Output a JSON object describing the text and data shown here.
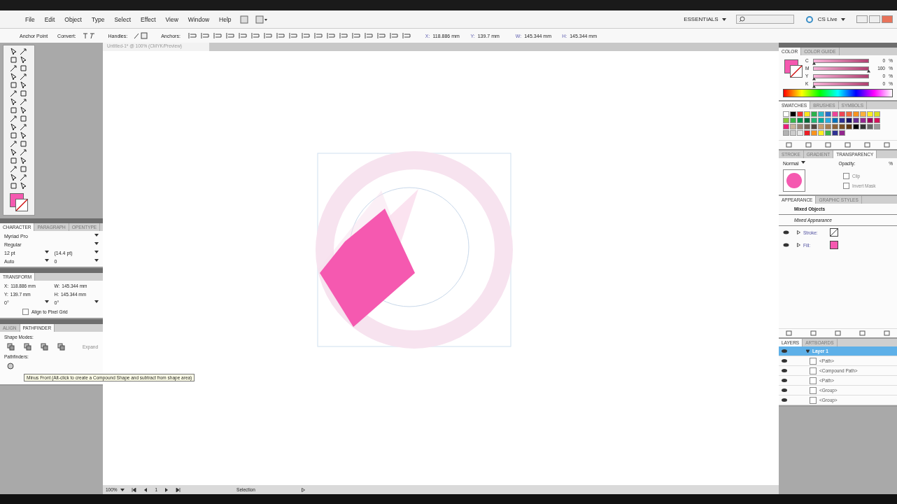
{
  "menu": [
    "File",
    "Edit",
    "Object",
    "Type",
    "Select",
    "Effect",
    "View",
    "Window",
    "Help"
  ],
  "workspace": "ESSENTIALS",
  "cs_live": "CS Live",
  "control_bar": {
    "tool": "Anchor Point",
    "convert": "Convert:",
    "handles": "Handles:",
    "anchors": "Anchors:",
    "fields": [
      {
        "label": "X:",
        "value": "118.886 mm"
      },
      {
        "label": "Y:",
        "value": "139.7 mm"
      },
      {
        "label": "W:",
        "value": "145.344 mm"
      },
      {
        "label": "H:",
        "value": "145.344 mm"
      }
    ]
  },
  "document_tab": "Untitled-1* @ 100% (CMYK/Preview)",
  "character": {
    "tabs": [
      {
        "label": "CHARACTER",
        "selected": true
      },
      {
        "label": "PARAGRAPH",
        "selected": false
      },
      {
        "label": "OPENTYPE",
        "selected": false
      }
    ],
    "font": "Myriad Pro",
    "style": "Regular",
    "size": "12 pt",
    "leading": "(14.4 pt)",
    "kerning": "Auto",
    "tracking": "0"
  },
  "transform": {
    "title": "TRANSFORM",
    "fields": [
      {
        "label": "X:",
        "value": "118.886 mm"
      },
      {
        "label": "W:",
        "value": "145.344 mm"
      },
      {
        "label": "Y:",
        "value": "139.7 mm"
      },
      {
        "label": "H:",
        "value": "145.344 mm"
      }
    ],
    "rotate": "0°",
    "shear": "0°",
    "pixel_grid": {
      "label": "Align to Pixel Grid",
      "checked": false
    }
  },
  "pathfinder": {
    "tabs": [
      {
        "label": "ALIGN",
        "selected": false
      },
      {
        "label": "PATHFINDER",
        "selected": true
      }
    ],
    "shape_modes": "Shape Modes:",
    "expand": {
      "label": "Expand",
      "disabled": true
    },
    "pathfinders": "Pathfinders:",
    "tooltip": "Minus Front (Alt-click to create a Compound Shape and subtract from shape area)"
  },
  "color": {
    "tabs": [
      {
        "label": "COLOR",
        "selected": true
      },
      {
        "label": "COLOR GUIDE",
        "selected": false
      }
    ],
    "channels": [
      {
        "name": "C",
        "value": "0",
        "level": 0
      },
      {
        "name": "M",
        "value": "100",
        "level": 1
      },
      {
        "name": "Y",
        "value": "0",
        "level": 0
      },
      {
        "name": "K",
        "value": "0",
        "level": 0
      }
    ],
    "unit": "%"
  },
  "swatches": {
    "tabs": [
      {
        "label": "SWATCHES",
        "selected": true
      },
      {
        "label": "BRUSHES",
        "selected": false
      },
      {
        "label": "SYMBOLS",
        "selected": false
      }
    ],
    "colors": [
      {
        "color": "#ffffff"
      },
      {
        "color": "#000000"
      },
      {
        "color": "#ee3333"
      },
      {
        "color": "#f8e71c"
      },
      {
        "color": "#2bb24c"
      },
      {
        "color": "#2ab8c8"
      },
      {
        "color": "#2a6fc8"
      },
      {
        "color": "#ee4499"
      },
      {
        "color": "#ee4455"
      },
      {
        "color": "#f26a3a"
      },
      {
        "color": "#f7931e"
      },
      {
        "color": "#fbb03b"
      },
      {
        "color": "#fcee21"
      },
      {
        "color": "#d9e021"
      },
      {
        "color": "#8cc63f"
      },
      {
        "color": "#39b54a"
      },
      {
        "color": "#009245"
      },
      {
        "color": "#006837"
      },
      {
        "color": "#22b573"
      },
      {
        "color": "#00a99d"
      },
      {
        "color": "#29abe2"
      },
      {
        "color": "#0071bc"
      },
      {
        "color": "#2e3192"
      },
      {
        "color": "#1b1464"
      },
      {
        "color": "#662d91"
      },
      {
        "color": "#93278f"
      },
      {
        "color": "#9e005d"
      },
      {
        "color": "#d4145a"
      },
      {
        "color": "#ed1e79"
      },
      {
        "color": "#c7b299"
      },
      {
        "color": "#998675"
      },
      {
        "color": "#736357"
      },
      {
        "color": "#534741"
      },
      {
        "color": "#c69c6d"
      },
      {
        "color": "#a67c52"
      },
      {
        "color": "#8c6239"
      },
      {
        "color": "#754c24"
      },
      {
        "color": "#603813"
      },
      {
        "color": "#000000"
      },
      {
        "color": "#333333"
      },
      {
        "color": "#666666"
      },
      {
        "color": "#999999"
      },
      {
        "color": "#b3b3b3"
      },
      {
        "color": "#cccccc"
      },
      {
        "color": "#e6e6e6"
      },
      {
        "color": "#ed1c24"
      },
      {
        "color": "#f7931e"
      },
      {
        "color": "#fcee21"
      },
      {
        "color": "#39b54a"
      },
      {
        "color": "#2e3192"
      },
      {
        "color": "#93278f"
      }
    ]
  },
  "transparency": {
    "tabs": [
      {
        "label": "STROKE",
        "selected": false
      },
      {
        "label": "GRADIENT",
        "selected": false
      },
      {
        "label": "TRANSPARENCY",
        "selected": true
      }
    ],
    "mode": "Normal",
    "opacity": "Opacity:",
    "unit": "%",
    "clip": {
      "label": "Clip",
      "checked": false
    },
    "invert": {
      "label": "Invert Mask",
      "checked": false
    }
  },
  "appearance": {
    "tabs": [
      {
        "label": "APPEARANCE",
        "selected": true
      },
      {
        "label": "GRAPHIC STYLES",
        "selected": false
      }
    ],
    "title": "Mixed Objects",
    "subtitle": "Mixed Appearance",
    "rows": [
      {
        "kind": "stroke",
        "label": "Stroke:"
      },
      {
        "kind": "fill",
        "label": "Fill:"
      }
    ]
  },
  "layers": {
    "tabs": [
      {
        "label": "LAYERS",
        "selected": true
      },
      {
        "label": "ARTBOARDS",
        "selected": false
      }
    ],
    "items": [
      {
        "name": "Layer 1",
        "selected": true,
        "expanded": true,
        "children": [
          {
            "name": "<Path>",
            "selected": false
          },
          {
            "name": "<Compound Path>",
            "selected": false
          },
          {
            "name": "<Path>",
            "selected": false
          },
          {
            "name": "<Group>",
            "selected": false
          },
          {
            "name": "<Group>",
            "selected": false
          }
        ]
      }
    ]
  },
  "status": {
    "zoom": "100%",
    "page": "1",
    "tool": "Selection"
  }
}
